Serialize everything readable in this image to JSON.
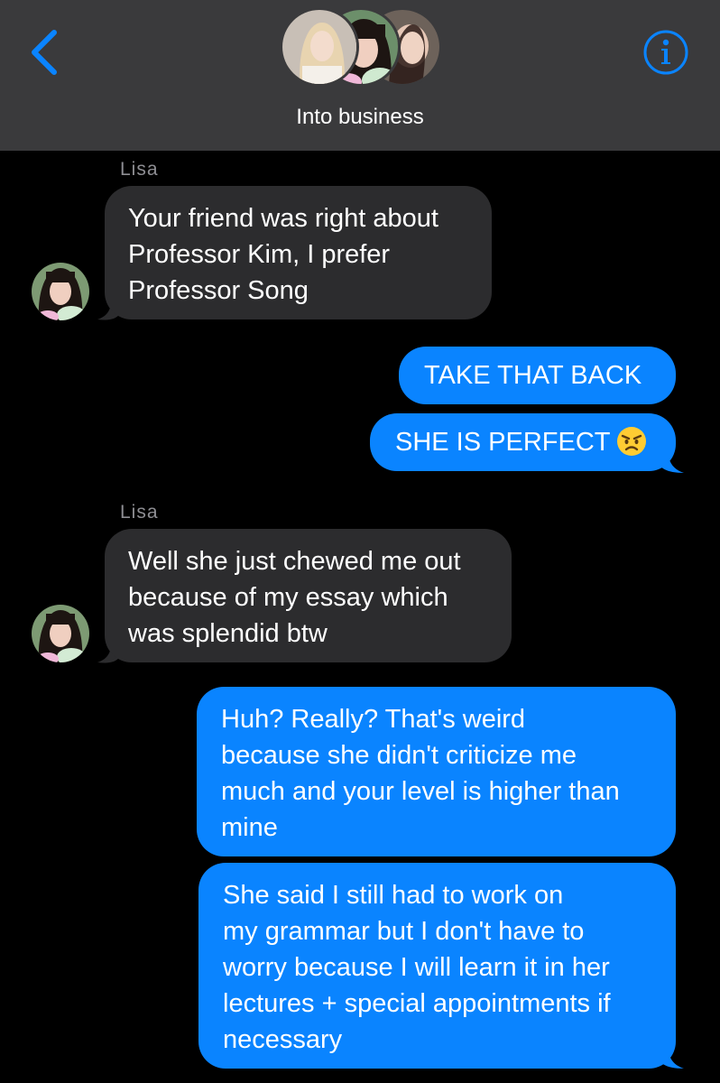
{
  "header": {
    "title": "Into business",
    "back_icon": "chevron-left-icon",
    "info_icon": "info-icon",
    "accent": "#0a84ff",
    "background": "#3a3a3c"
  },
  "messages": [
    {
      "direction": "incoming",
      "sender": "Lisa",
      "lines": [
        "Your friend was right about",
        "Professor Kim, I prefer",
        "Professor Song"
      ]
    },
    {
      "direction": "outgoing",
      "text": "TAKE THAT BACK"
    },
    {
      "direction": "outgoing",
      "text": "SHE IS PERFECT",
      "emoji": "angry-face-emoji"
    },
    {
      "direction": "incoming",
      "sender": "Lisa",
      "lines": [
        "Well she just chewed me out",
        "because of my essay which",
        "was splendid btw"
      ]
    },
    {
      "direction": "outgoing",
      "lines": [
        "Huh? Really? That's weird",
        "because she didn't criticize me",
        "much and your level is higher than",
        "mine"
      ]
    },
    {
      "direction": "outgoing",
      "lines": [
        "She said I still had to work on",
        "my grammar but I don't have to",
        "worry because I will learn it in her",
        "lectures + special appointments if",
        "necessary"
      ]
    }
  ],
  "colors": {
    "incoming_bubble": "#2c2c2e",
    "outgoing_bubble": "#0a84ff",
    "sender_label": "#8e8e93"
  }
}
